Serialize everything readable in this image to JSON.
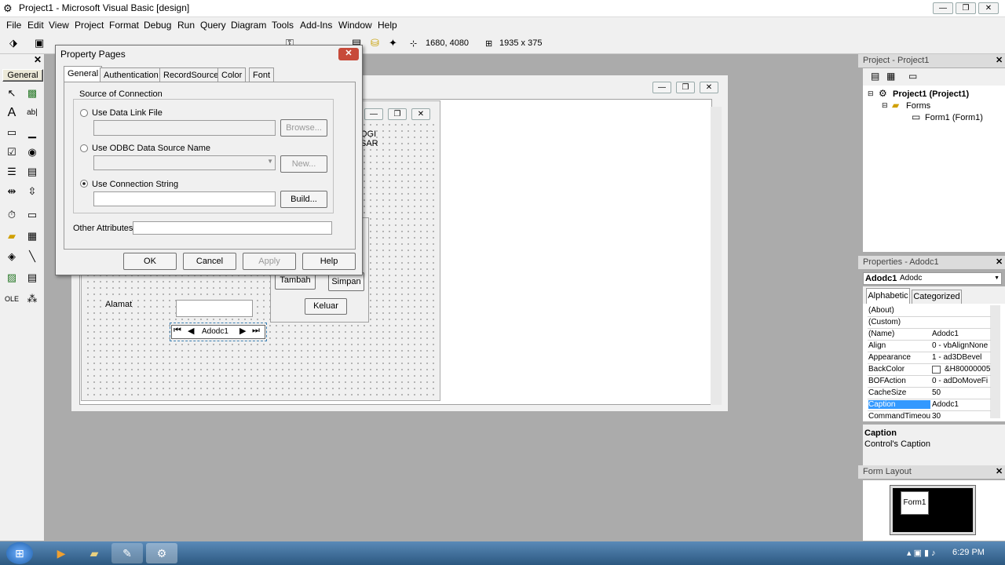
{
  "window": {
    "title": "Project1 - Microsoft Visual Basic [design]"
  },
  "menu": [
    "File",
    "Edit",
    "View",
    "Project",
    "Format",
    "Debug",
    "Run",
    "Query",
    "Diagram",
    "Tools",
    "Add-Ins",
    "Window",
    "Help"
  ],
  "toolbar": {
    "position": "1680, 4080",
    "size": "1935 x 375"
  },
  "toolbox": {
    "tab": "General"
  },
  "dialog": {
    "title": "Property Pages",
    "tabs": [
      "General",
      "Authentication",
      "RecordSource",
      "Color",
      "Font"
    ],
    "group_label": "Source of Connection",
    "opt_data_link": "Use Data Link File",
    "browse": "Browse...",
    "opt_odbc": "Use ODBC Data Source Name",
    "new": "New...",
    "opt_conn": "Use Connection String",
    "build": "Build...",
    "other_attr": "Other Attributes:",
    "ok": "OK",
    "cancel": "Cancel",
    "apply": "Apply",
    "help": "Help"
  },
  "form": {
    "title_frag_1": "OGI",
    "title_frag_2": "SAR",
    "tambah": "Tambah",
    "simpan": "Simpan",
    "keluar": "Keluar",
    "alamat": "Alamat",
    "adodc": "Adodc1"
  },
  "project": {
    "header": "Project - Project1",
    "root": "Project1 (Project1)",
    "folder": "Forms",
    "form": "Form1 (Form1)"
  },
  "properties": {
    "header": "Properties - Adodc1",
    "object": "Adodc1",
    "object_type": "Adodc",
    "tab_alpha": "Alphabetic",
    "tab_cat": "Categorized",
    "rows": [
      {
        "k": "(About)",
        "v": ""
      },
      {
        "k": "(Custom)",
        "v": ""
      },
      {
        "k": "(Name)",
        "v": "Adodc1"
      },
      {
        "k": "Align",
        "v": "0 - vbAlignNone"
      },
      {
        "k": "Appearance",
        "v": "1 - ad3DBevel"
      },
      {
        "k": "BackColor",
        "v": "&H80000005"
      },
      {
        "k": "BOFAction",
        "v": "0 - adDoMoveFi"
      },
      {
        "k": "CacheSize",
        "v": "50"
      },
      {
        "k": "Caption",
        "v": "Adodc1"
      },
      {
        "k": "CommandTimeout",
        "v": "30"
      }
    ],
    "desc_title": "Caption",
    "desc_text": "Control's Caption"
  },
  "form_layout": {
    "header": "Form Layout",
    "form": "Form1"
  },
  "taskbar": {
    "time": "6:29 PM"
  }
}
